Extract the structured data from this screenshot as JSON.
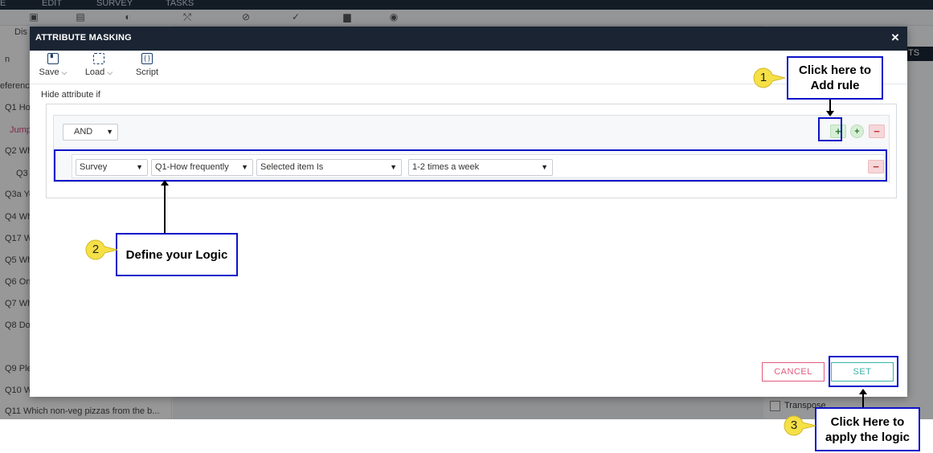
{
  "background": {
    "topbar_tabs": [
      "E",
      "EDIT",
      "SURVEY",
      "TASKS"
    ],
    "left_items": [
      "Dis",
      "n",
      "eferenc",
      "Q1 Ho",
      "Jump",
      "Q2 Wh",
      "Q3",
      "Q3a Yo",
      "Q4 Wh",
      "Q17 W",
      "Q5 Wh",
      "Q6 On",
      "Q7 Wh",
      "Q8 Do",
      "Q9 Ple",
      "Q10 W",
      "Q11 Which non-veg pizzas from the b..."
    ],
    "right_header": "TS",
    "right_option": "Transpose"
  },
  "modal": {
    "title": "ATTRIBUTE MASKING",
    "close_glyph": "×"
  },
  "toolbar": {
    "save_label": "Save",
    "load_label": "Load",
    "script_label": "Script",
    "script_icon_glyph": "{ }",
    "chevron": "⌵"
  },
  "rules": {
    "heading": "Hide attribute if",
    "conjunction": "AND",
    "add_rule_glyph": "+",
    "add_group_glyph": "+",
    "delete_glyph": "−",
    "rule_row": {
      "source": "Survey",
      "question": "Q1-How frequently",
      "operator": "Selected item Is",
      "value": "1-2 times a week"
    }
  },
  "footer": {
    "cancel_label": "CANCEL",
    "set_label": "SET"
  },
  "annotations": [
    {
      "number": "1",
      "text": "Click here to Add rule"
    },
    {
      "number": "2",
      "text": "Define your Logic"
    },
    {
      "number": "3",
      "text": "Click Here to apply the logic"
    }
  ],
  "colors": {
    "modal_header": "#1a2432",
    "highlight": "#0b12c9",
    "cancel": "#e25b7d",
    "set": "#39b3a5",
    "badge": "#f5e046"
  }
}
